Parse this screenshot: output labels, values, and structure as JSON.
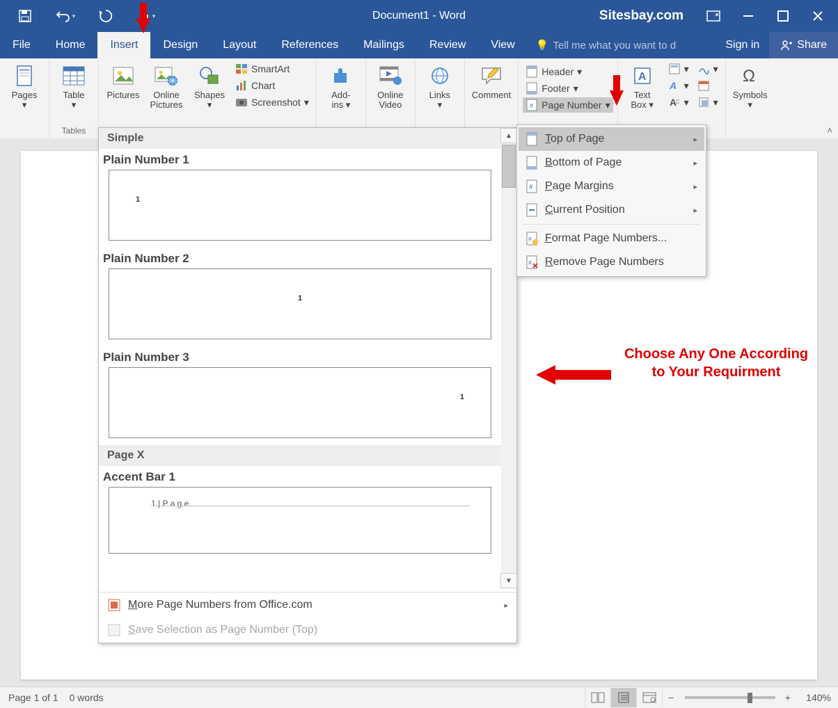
{
  "title": "Document1 - Word",
  "watermark": "Sitesbay.com",
  "tabs": [
    "File",
    "Home",
    "Insert",
    "Design",
    "Layout",
    "References",
    "Mailings",
    "Review",
    "View"
  ],
  "tellme": "Tell me what you want to d",
  "signin": "Sign in",
  "share": "Share",
  "ribbon": {
    "pages": "Pages",
    "table": "Table",
    "tables_label": "Tables",
    "pictures": "Pictures",
    "online_pictures": "Online\nPictures",
    "shapes": "Shapes",
    "smartart": "SmartArt",
    "chart": "Chart",
    "screenshot": "Screenshot",
    "addins": "Add-\nins",
    "online_video": "Online\nVideo",
    "links": "Links",
    "comment": "Comment",
    "header": "Header",
    "footer": "Footer",
    "page_number": "Page Number",
    "textbox": "Text\nBox",
    "symbols": "Symbols"
  },
  "gallery": {
    "cat_simple": "Simple",
    "plain1": "Plain Number 1",
    "plain2": "Plain Number 2",
    "plain3": "Plain Number 3",
    "cat_pagex": "Page X",
    "accent1": "Accent Bar 1",
    "accent_text": "1 | P a g e",
    "more": "More Page Numbers from Office.com",
    "save_sel": "Save Selection as Page Number (Top)"
  },
  "submenu": {
    "top": "Top of Page",
    "bottom": "Bottom of Page",
    "margins": "Page Margins",
    "current": "Current Position",
    "format": "Format Page Numbers...",
    "remove": "Remove Page Numbers"
  },
  "annotation": {
    "line1": "Choose Any One According",
    "line2": "to Your Requirment"
  },
  "status": {
    "page": "Page 1 of 1",
    "words": "0 words",
    "zoom": "140%"
  }
}
